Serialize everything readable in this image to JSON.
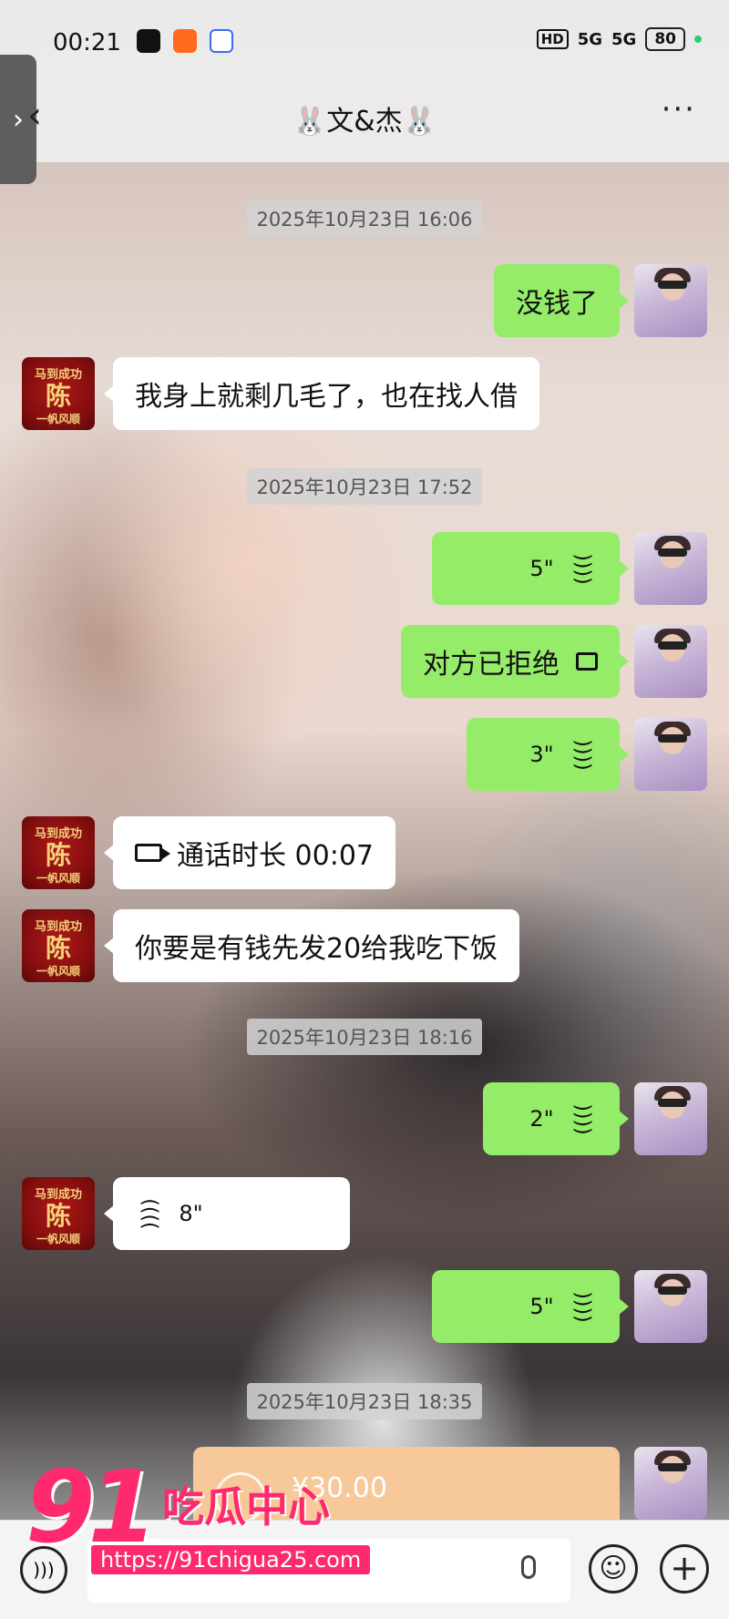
{
  "status": {
    "time": "00:21",
    "signal_a": "5G",
    "signal_b": "5G",
    "hd": "HD",
    "battery": "80"
  },
  "header": {
    "title": "🐰文&杰🐰",
    "back_label": "‹",
    "more_label": "···"
  },
  "chat": {
    "timestamps": [
      "2025年10月23日 16:06",
      "2025年10月23日 17:52",
      "2025年10月23日 18:16",
      "2025年10月23日 18:35"
    ],
    "messages": [
      {
        "from": "me",
        "type": "text",
        "text": "没钱了"
      },
      {
        "from": "them",
        "type": "text",
        "text": "我身上就剩几毛了，也在找人借"
      },
      {
        "from": "me",
        "type": "voice",
        "duration": "5\""
      },
      {
        "from": "me",
        "type": "call-rejected",
        "text": "对方已拒绝"
      },
      {
        "from": "me",
        "type": "voice",
        "duration": "3\""
      },
      {
        "from": "them",
        "type": "video-call",
        "text": "通话时长 00:07"
      },
      {
        "from": "them",
        "type": "text",
        "text": "你要是有钱先发20给我吃下饭"
      },
      {
        "from": "me",
        "type": "voice",
        "duration": "2\""
      },
      {
        "from": "them",
        "type": "voice",
        "duration": "8\""
      },
      {
        "from": "me",
        "type": "voice",
        "duration": "5\""
      },
      {
        "from": "me",
        "type": "transfer",
        "amount": "¥30.00"
      }
    ],
    "avatar_them": {
      "top": "马到成功",
      "middle": "陈",
      "bottom": "一帆风顺"
    }
  },
  "watermark": {
    "number": "91",
    "text": "吃瓜中心",
    "url": "https://91chigua25.com"
  },
  "colors": {
    "my_bubble": "#95ec69",
    "their_bubble": "#ffffff",
    "watermark": "#ff2a6d",
    "transfer": "#f7c99a"
  }
}
